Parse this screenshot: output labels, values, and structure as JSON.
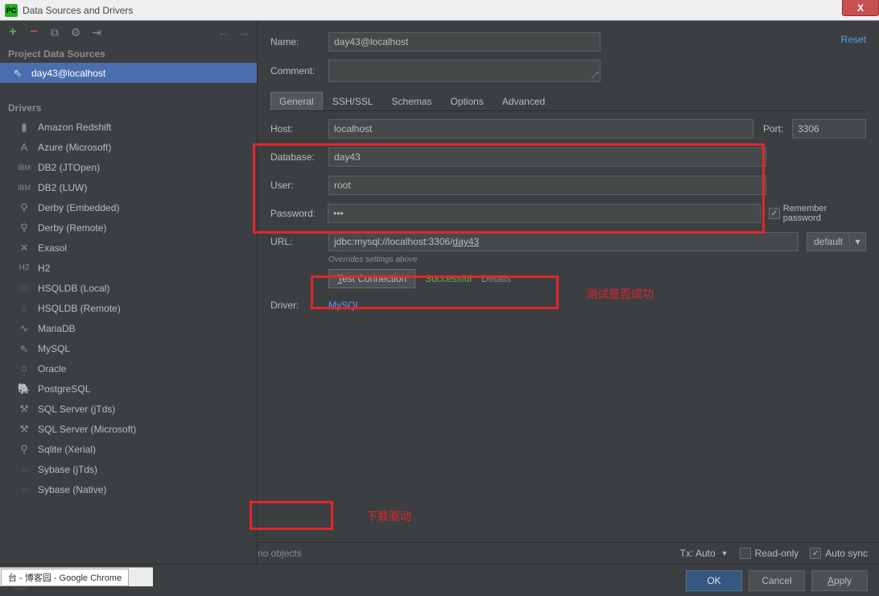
{
  "window": {
    "title": "Data Sources and Drivers",
    "close_icon": "X"
  },
  "left": {
    "section1": "Project Data Sources",
    "selected_source": "day43@localhost",
    "section2": "Drivers",
    "drivers": [
      "Amazon Redshift",
      "Azure (Microsoft)",
      "DB2 (JTOpen)",
      "DB2 (LUW)",
      "Derby (Embedded)",
      "Derby (Remote)",
      "Exasol",
      "H2",
      "HSQLDB (Local)",
      "HSQLDB (Remote)",
      "MariaDB",
      "MySQL",
      "Oracle",
      "PostgreSQL",
      "SQL Server (jTds)",
      "SQL Server (Microsoft)",
      "Sqlite (Xerial)",
      "Sybase (jTds)",
      "Sybase (Native)"
    ]
  },
  "right": {
    "reset": "Reset",
    "labels": {
      "name": "Name:",
      "comment": "Comment:",
      "host": "Host:",
      "port": "Port:",
      "database": "Database:",
      "user": "User:",
      "password": "Password:",
      "url": "URL:",
      "driver": "Driver:"
    },
    "values": {
      "name": "day43@localhost",
      "host": "localhost",
      "port": "3306",
      "database": "day43",
      "user": "root",
      "password": "•••",
      "url_prefix": "jdbc:mysql://localhost:3306/",
      "url_db": "day43",
      "driver": "MySQL"
    },
    "tabs": [
      "General",
      "SSH/SSL",
      "Schemas",
      "Options",
      "Advanced"
    ],
    "remember_pw": "Remember password",
    "url_select": "default",
    "override_note": "Overrides settings above",
    "test_btn_initial": "T",
    "test_btn_rest": "est Connection",
    "test_success": "Successful",
    "test_details": "Details",
    "status": {
      "no_objects": "no objects",
      "tx": "Tx: Auto",
      "read_only": "Read-only",
      "auto_sync": "Auto sync"
    }
  },
  "annotations": {
    "test_note": "测试是否成功",
    "download_note": "下载驱动"
  },
  "footer": {
    "ok": "OK",
    "cancel": "Cancel",
    "apply": "Apply"
  },
  "taskbar": {
    "label": "台 - 博客园 - Google Chrome"
  }
}
